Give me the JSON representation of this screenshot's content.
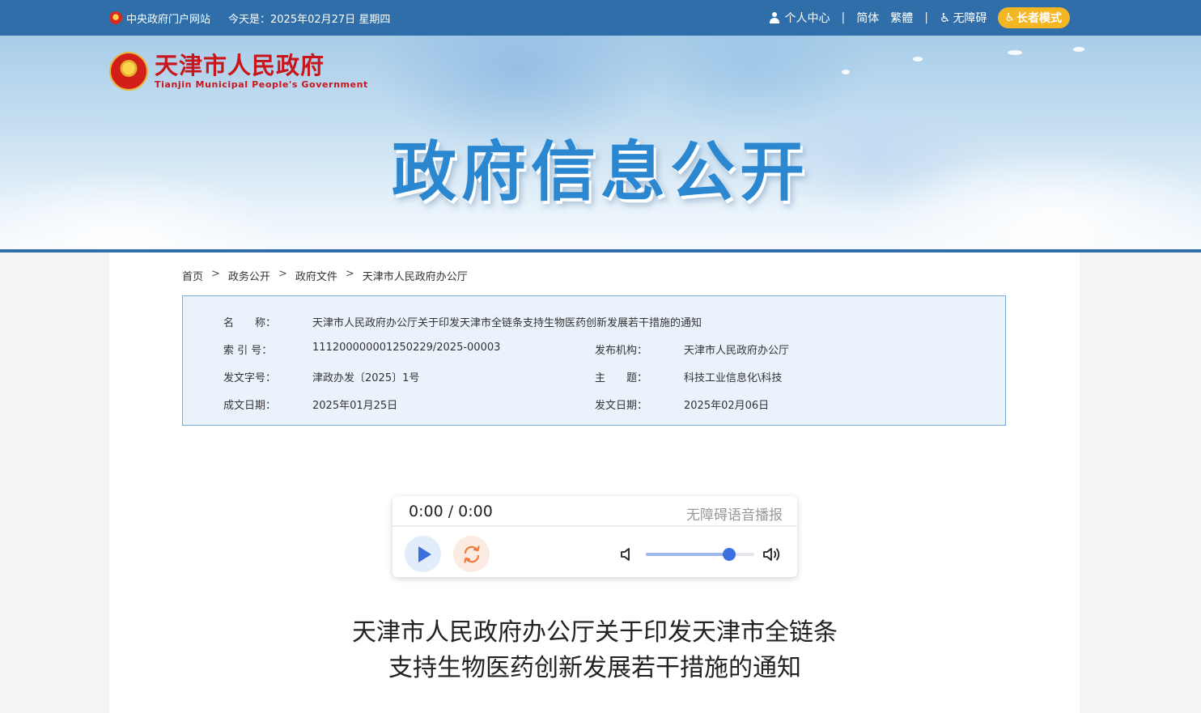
{
  "topbar": {
    "portal_link": "中央政府门户网站",
    "today": "今天是：2025年02月27日 星期四",
    "personal_center": "个人中心",
    "simplified": "简体",
    "traditional": "繁體",
    "accessibility": "无障碍",
    "elder_mode": "长者模式",
    "separator": "|",
    "bar_color": "#2f6ea8"
  },
  "header": {
    "site_name_cn": "天津市人民政府",
    "site_name_en": "Tianjin Municipal People's Government",
    "banner_title": "政府信息公开"
  },
  "breadcrumb": {
    "items": [
      "首页",
      "政务公开",
      "政府文件",
      "天津市人民政府办公厅"
    ],
    "separator": ">"
  },
  "info": {
    "name_label": "名　　称：",
    "name_value": "天津市人民政府办公厅关于印发天津市全链条支持生物医药创新发展若干措施的通知",
    "index_label": "索 引 号：",
    "index_value": "111200000001250229/2025-00003",
    "issuer_label": "发布机构：",
    "issuer_value": "天津市人民政府办公厅",
    "docno_label": "发文字号：",
    "docno_value": "津政办发〔2025〕1号",
    "topic_label": "主　　题：",
    "topic_value": "科技工业信息化\\科技",
    "created_label": "成文日期：",
    "created_value": "2025年01月25日",
    "published_label": "发文日期：",
    "published_value": "2025年02月06日"
  },
  "player": {
    "time": "0:00 / 0:00",
    "title": "无障碍语音播报",
    "volume": 0.77,
    "play_color": "#3b6fe0",
    "loop_color": "#f07a3a"
  },
  "document": {
    "title_line1": "天津市人民政府办公厅关于印发天津市全链条",
    "title_line2": "支持生物医药创新发展若干措施的通知"
  }
}
